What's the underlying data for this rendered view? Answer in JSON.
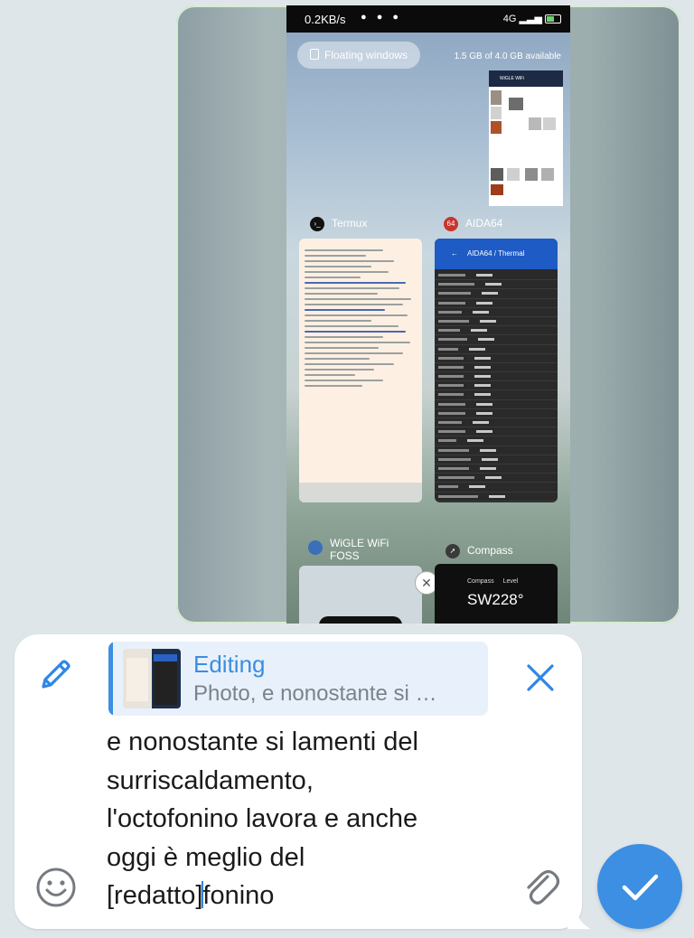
{
  "photo": {
    "status_bar": {
      "speed": "0.2KB/s",
      "network": "4G"
    },
    "floating_windows_label": "Floating windows",
    "memory_label": "1.5 GB of 4.0 GB available",
    "top_thumb_title": "WiGLE WiFi",
    "apps": [
      {
        "name": "Termux",
        "icon": "termux-icon"
      },
      {
        "name": "AIDA64",
        "icon": "aida64-icon",
        "icon_text": "64",
        "screen_title": "AIDA64  /  Thermal"
      },
      {
        "name": "WiGLE WiFi FOSS",
        "icon": "wigle-icon"
      },
      {
        "name": "Compass",
        "icon": "compass-icon",
        "tabs": [
          "Compass",
          "Level"
        ],
        "direction": "SW228°"
      }
    ]
  },
  "composer": {
    "reply": {
      "title": "Editing",
      "subtitle": "Photo, e nonostante si …"
    },
    "message_text": "e nonostante si lamenti del\nsurriscaldamento,\nl'octofonino lavora e anche\noggi è meglio del\n[redatto]",
    "message_text_after_caret": "fonino"
  },
  "colors": {
    "accent": "#3c8fe3",
    "icon_blue": "#2e87e6",
    "icon_gray": "#757b80",
    "background": "#dfe6ea",
    "reply_bg": "#e8f1fb"
  },
  "icons": {
    "edit": "pencil-icon",
    "close": "close-icon",
    "emoji": "smiley-icon",
    "attach": "paperclip-icon",
    "send": "checkmark-icon"
  }
}
